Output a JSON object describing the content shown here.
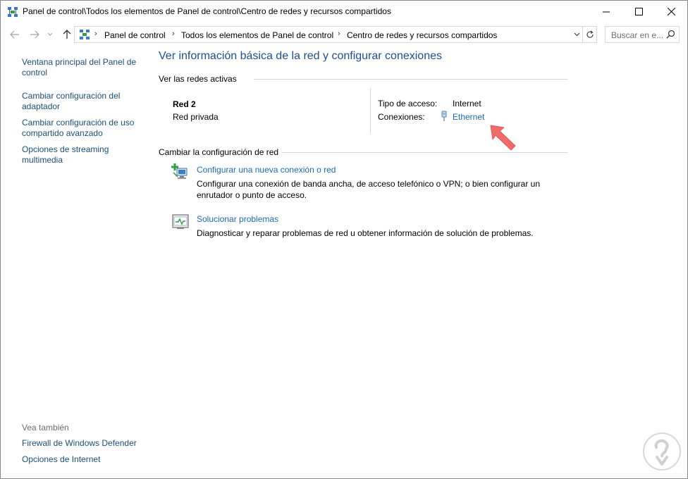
{
  "window": {
    "title": "Panel de control\\Todos los elementos de Panel de control\\Centro de redes y recursos compartidos"
  },
  "address": {
    "crumbs": [
      "Panel de control",
      "Todos los elementos de Panel de control",
      "Centro de redes y recursos compartidos"
    ],
    "search_placeholder": "Buscar en e..."
  },
  "sidebar": {
    "links": [
      "Ventana principal del Panel de control",
      "Cambiar configuración del adaptador",
      "Cambiar configuración de uso compartido avanzado",
      "Opciones de streaming multimedia"
    ],
    "see_also_label": "Vea también",
    "see_also": [
      "Firewall de Windows Defender",
      "Opciones de Internet"
    ]
  },
  "main": {
    "title": "Ver información básica de la red y configurar conexiones",
    "active_networks_header": "Ver las redes activas",
    "network": {
      "name": "Red  2",
      "type": "Red privada",
      "access_label": "Tipo de acceso:",
      "access_value": "Internet",
      "connections_label": "Conexiones:",
      "connection_link": "Ethernet"
    },
    "change_header": "Cambiar la configuración de red",
    "tasks": [
      {
        "link": "Configurar una nueva conexión o red",
        "desc": "Configurar una conexión de banda ancha, de acceso telefónico o VPN; o bien configurar un enrutador o punto de acceso."
      },
      {
        "link": "Solucionar problemas",
        "desc": "Diagnosticar y reparar problemas de red u obtener información de solución de problemas."
      }
    ]
  },
  "colors": {
    "link": "#1a6ab5",
    "title": "#1e4f91",
    "sidebar_link": "#1a4e7a",
    "arrow": "#f26b6b"
  }
}
